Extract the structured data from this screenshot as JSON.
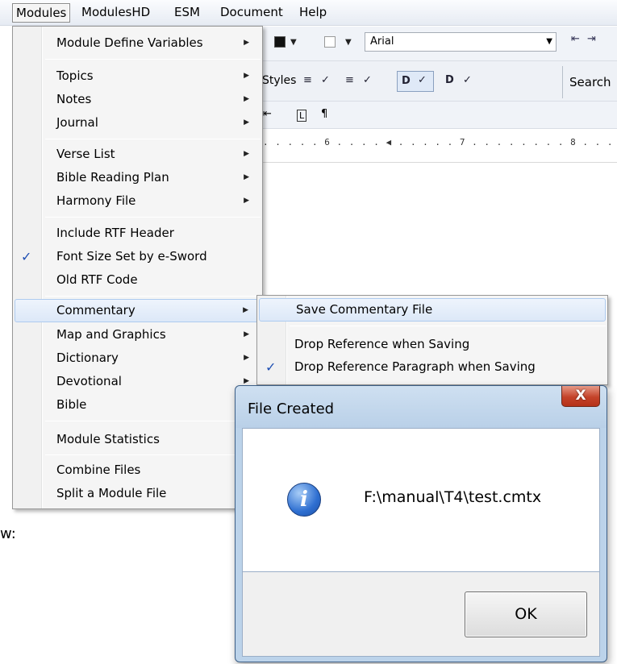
{
  "menubar": {
    "items": [
      "Modules",
      "ModulesHD",
      "ESM",
      "Document",
      "Help"
    ]
  },
  "toolbar": {
    "font_name": "Arial",
    "styles_label": "Styles",
    "search_label": "Search",
    "styles_icons": [
      "≡",
      "✓",
      "≡",
      "✓",
      "D",
      "✓",
      "D",
      "✓"
    ],
    "paragraph_mark": "¶",
    "ruler_marks": ". . . . . 6 . . . . ◀ . . . . . 7 . . . . . . . . 8 . . . ."
  },
  "background_text": "w:",
  "modules_menu": {
    "items": [
      {
        "label": "Module Define Variables",
        "submenu": true
      },
      {
        "label": "Topics",
        "submenu": true
      },
      {
        "label": "Notes",
        "submenu": true
      },
      {
        "label": "Journal",
        "submenu": true
      },
      {
        "label": "Verse List",
        "submenu": true
      },
      {
        "label": "Bible Reading Plan",
        "submenu": true
      },
      {
        "label": "Harmony File",
        "submenu": true
      },
      {
        "label": "Include RTF Header",
        "submenu": false
      },
      {
        "label": "Font Size Set by e-Sword",
        "submenu": false,
        "checked": true
      },
      {
        "label": "Old RTF Code",
        "submenu": false
      },
      {
        "label": "Commentary",
        "submenu": true,
        "highlighted": true
      },
      {
        "label": "Map and Graphics",
        "submenu": true
      },
      {
        "label": "Dictionary",
        "submenu": true
      },
      {
        "label": "Devotional",
        "submenu": true
      },
      {
        "label": "Bible",
        "submenu": false
      },
      {
        "label": "Module Statistics",
        "submenu": false
      },
      {
        "label": "Combine Files",
        "submenu": false
      },
      {
        "label": "Split a Module File",
        "submenu": false
      }
    ]
  },
  "commentary_menu": {
    "items": [
      {
        "label": "Save Commentary File",
        "highlighted": true
      },
      {
        "label": "Drop Reference when Saving"
      },
      {
        "label": "Drop Reference Paragraph when Saving",
        "checked": true
      }
    ]
  },
  "dialog": {
    "title": "File Created",
    "close_glyph": "X",
    "icon_glyph": "i",
    "message": "F:\\manual\\T4\\test.cmtx",
    "ok_label": "OK"
  },
  "glyphs": {
    "check": "✓",
    "submenu_arrow": "▶"
  },
  "colors": {
    "highlight_border": "#aecbef",
    "check": "#1f4fb3",
    "close_button": "#c4432a"
  }
}
